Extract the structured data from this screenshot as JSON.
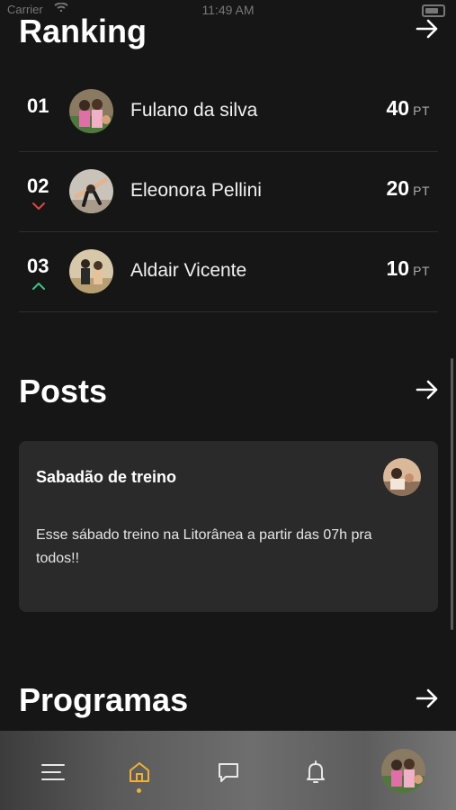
{
  "status_bar": {
    "carrier": "Carrier",
    "time": "11:49 AM"
  },
  "ranking": {
    "title": "Ranking",
    "rows": [
      {
        "position": "01",
        "name": "Fulano da silva",
        "score": "40",
        "unit": "PT",
        "change": "none"
      },
      {
        "position": "02",
        "name": "Eleonora Pellini",
        "score": "20",
        "unit": "PT",
        "change": "down"
      },
      {
        "position": "03",
        "name": "Aldair Vicente",
        "score": "10",
        "unit": "PT",
        "change": "up"
      }
    ]
  },
  "posts": {
    "title": "Posts",
    "items": [
      {
        "title": "Sabadão de treino",
        "body": "Esse sábado treino na Litorânea a partir das 07h pra todos!!"
      }
    ]
  },
  "programas": {
    "title": "Programas"
  },
  "tabbar": {
    "items": [
      {
        "name": "menu-icon",
        "active": false
      },
      {
        "name": "home-icon",
        "active": true
      },
      {
        "name": "chat-icon",
        "active": false
      },
      {
        "name": "bell-icon",
        "active": false
      },
      {
        "name": "profile-avatar",
        "active": false
      }
    ]
  },
  "colors": {
    "background": "#161616",
    "card": "#2a2a2a",
    "accent": "#f2b230",
    "down": "#e0453d",
    "up": "#38c486"
  }
}
